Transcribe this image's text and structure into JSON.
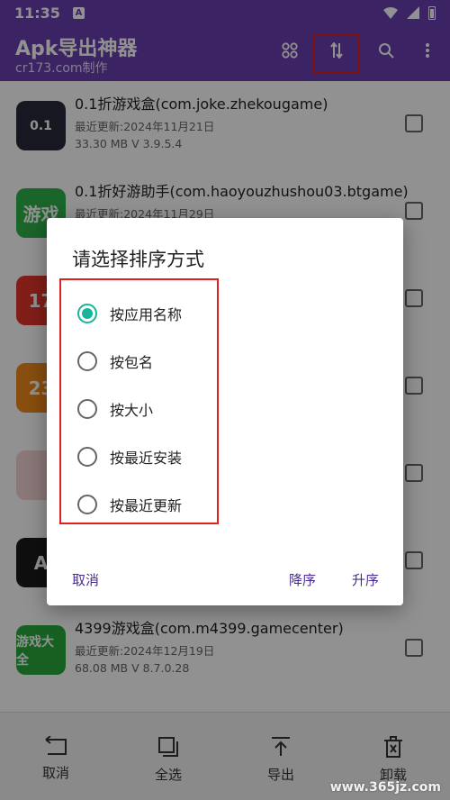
{
  "statusbar": {
    "time": "11:35",
    "notif_glyph": "A"
  },
  "appbar": {
    "title": "Apk导出神器",
    "subtitle": "cr173.com制作",
    "actions": [
      "grid-view-icon",
      "sort-icon",
      "search-icon",
      "more-vert-icon"
    ]
  },
  "apps": [
    {
      "name": "0.1折游戏盒(com.joke.zhekougame)",
      "date": "最近更新:2024年11月21日",
      "size": "33.30 MB   V 3.9.5.4",
      "icon_text": "0.1",
      "icon_color": "#2a2a3a"
    },
    {
      "name": "0.1折好游助手(com.haoyouzhushou03.btgame)",
      "date": "最近更新:2024年11月29日",
      "size": "",
      "icon_text": "游戏",
      "icon_color": "#2fb24a"
    },
    {
      "name": "",
      "date": "",
      "size": "",
      "icon_text": "17",
      "icon_color": "#e4352b"
    },
    {
      "name": "",
      "date": "",
      "size": "",
      "icon_text": "23",
      "icon_color": "#f08a1c"
    },
    {
      "name": "",
      "date": "",
      "size": "",
      "icon_text": "",
      "icon_color": "#f4d4d4"
    },
    {
      "name": "",
      "date": "",
      "size": "",
      "icon_text": "A",
      "icon_color": "#1b1b1b"
    },
    {
      "name": "4399游戏盒(com.m4399.gamecenter)",
      "date": "最近更新:2024年12月19日",
      "size": "68.08 MB   V 8.7.0.28",
      "icon_text": "游戏大全",
      "icon_color": "#29a93d"
    }
  ],
  "dialog": {
    "title": "请选择排序方式",
    "options": [
      {
        "label": "按应用名称",
        "checked": true
      },
      {
        "label": "按包名",
        "checked": false
      },
      {
        "label": "按大小",
        "checked": false
      },
      {
        "label": "按最近安装",
        "checked": false
      },
      {
        "label": "按最近更新",
        "checked": false
      }
    ],
    "cancel": "取消",
    "descending": "降序",
    "ascending": "升序"
  },
  "bottombar": {
    "cancel": "取消",
    "select_all": "全选",
    "export": "导出",
    "uninstall": "卸载"
  },
  "watermark": "www.365jz.com",
  "colors": {
    "primary": "#6a3fb0",
    "accent": "#17b59a",
    "highlight": "#e0201c",
    "dialog_button": "#4a2a93"
  }
}
